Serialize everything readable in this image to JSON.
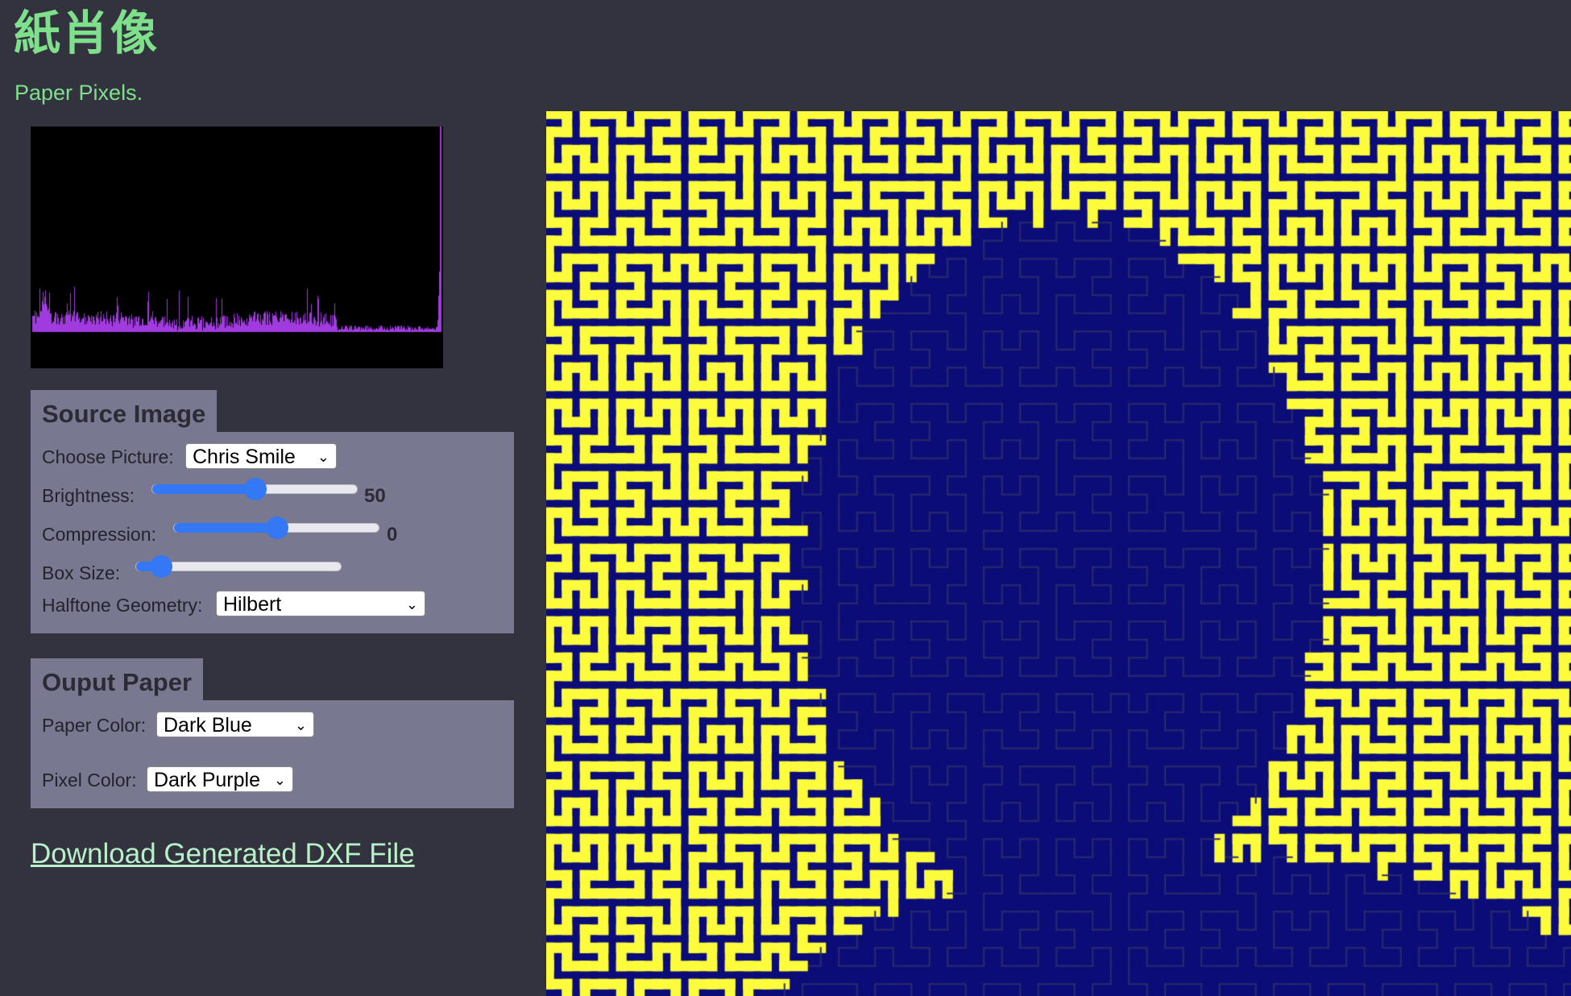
{
  "header": {
    "title": "紙肖像",
    "subtitle": "Paper Pixels."
  },
  "colors": {
    "background": "#33323f",
    "accent_green": "#7ee08a",
    "panel": "#787891",
    "histogram_bar": "#a13be0",
    "slider_blue": "#3478f6",
    "paper_dark_blue": "#0c0c78",
    "pixel_yellow": "#fcfc3c",
    "link": "#b8f0c8"
  },
  "source_image": {
    "heading": "Source Image",
    "choose_picture_label": "Choose Picture:",
    "choose_picture_value": "Chris Smile",
    "brightness_label": "Brightness:",
    "brightness_value": 50,
    "brightness_display": "50",
    "compression_label": "Compression:",
    "compression_value": 0,
    "compression_display": "0",
    "box_size_label": "Box Size:",
    "box_size_fraction": 0.12,
    "halftone_label": "Halftone Geometry:",
    "halftone_value": "Hilbert"
  },
  "output_paper": {
    "heading": "Ouput Paper",
    "paper_color_label": "Paper Color:",
    "paper_color_value": "Dark Blue",
    "pixel_color_label": "Pixel Color:",
    "pixel_color_value": "Dark Purple"
  },
  "download": {
    "label": "Download Generated DXF File"
  },
  "icons": {
    "dropdown": "chevron-down-icon"
  }
}
